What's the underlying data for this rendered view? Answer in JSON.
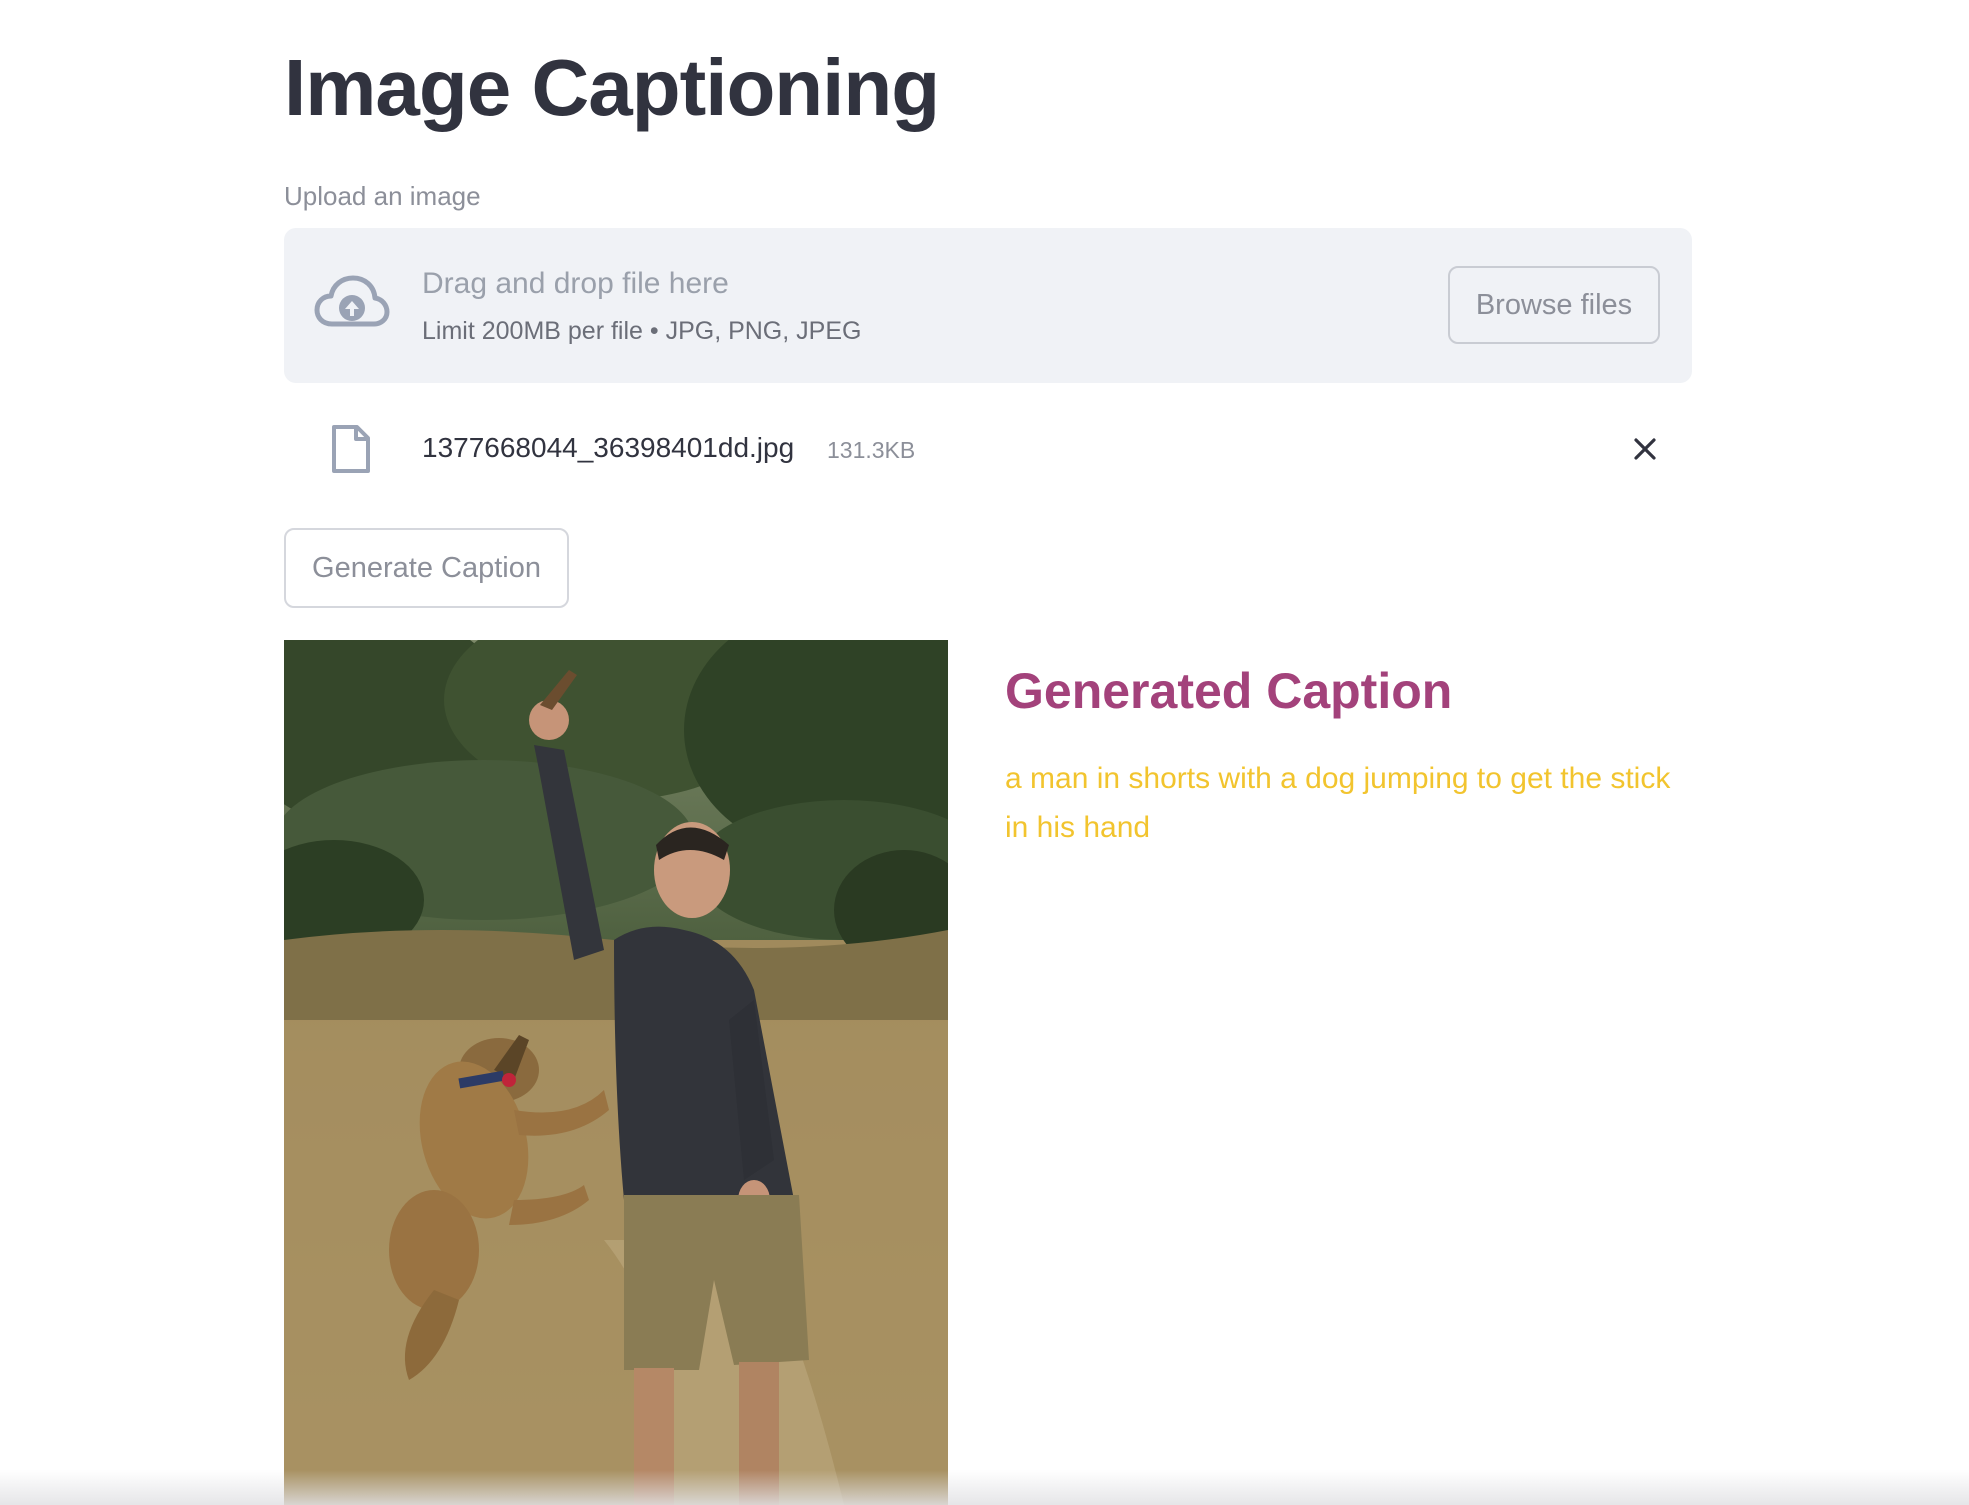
{
  "page": {
    "title": "Image Captioning"
  },
  "uploader": {
    "label": "Upload an image",
    "drop_title": "Drag and drop file here",
    "drop_subtitle": "Limit 200MB per file • JPG, PNG, JPEG",
    "browse_label": "Browse files",
    "icon": "cloud-upload-icon"
  },
  "file": {
    "name": "1377668044_36398401dd.jpg",
    "size": "131.3KB",
    "icon": "file-icon",
    "remove_icon": "close-icon"
  },
  "actions": {
    "generate_label": "Generate Caption"
  },
  "result": {
    "heading": "Generated Caption",
    "caption": "a man in shorts with a dog jumping to get the stick in his hand"
  },
  "colors": {
    "heading_accent": "#a3427b",
    "caption_text": "#f2c42e",
    "dropzone_bg": "#f0f2f6",
    "title_text": "#31333f"
  }
}
